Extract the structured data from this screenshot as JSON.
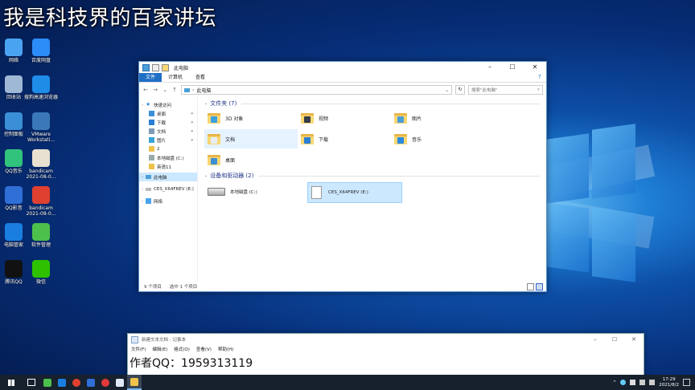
{
  "overlay_title": "我是科技界的百家讲坛",
  "desktop": {
    "icons": [
      {
        "label": "网络",
        "icon": "network-icon",
        "color": "#4aa3f0"
      },
      {
        "label": "百度网盘",
        "icon": "baidu-netdisk-icon",
        "color": "#2b8cf7"
      },
      {
        "label": "回收站",
        "icon": "recycle-bin-icon",
        "color": "#9fb8d6"
      },
      {
        "label": "搜狗高速浏览器",
        "icon": "sogou-browser-icon",
        "color": "#1f8ce8"
      },
      {
        "label": "控制面板",
        "icon": "control-panel-icon",
        "color": "#3b8fd6"
      },
      {
        "label": "VMware Workstati...",
        "icon": "vmware-icon",
        "color": "#3a78b8"
      },
      {
        "label": "QQ音乐",
        "icon": "qq-music-icon",
        "color": "#31c27c"
      },
      {
        "label": "bandicam 2021-08-0...",
        "icon": "video-file-icon",
        "color": "#e8e0d0"
      },
      {
        "label": "QQ影音",
        "icon": "qq-player-icon",
        "color": "#2f6fd6"
      },
      {
        "label": "bandicam 2021-08-0...",
        "icon": "bandicam-icon",
        "color": "#e04030"
      },
      {
        "label": "电脑管家",
        "icon": "pc-manager-icon",
        "color": "#1a7ee0"
      },
      {
        "label": "软件管理",
        "icon": "software-manager-icon",
        "color": "#4cbf4c"
      },
      {
        "label": "腾讯QQ",
        "icon": "qq-icon",
        "color": "#111111"
      },
      {
        "label": "微信",
        "icon": "wechat-icon",
        "color": "#2dc100"
      }
    ]
  },
  "explorer": {
    "title": "此电脑",
    "ribbon_tabs": [
      "文件",
      "计算机",
      "查看"
    ],
    "address": "此电脑",
    "search_placeholder": "搜索\"此电脑\"",
    "nav": {
      "quick_access": "快速访问",
      "items": [
        {
          "label": "桌面",
          "pinned": true,
          "icon": "desktop-icon",
          "color": "#3b8fd6"
        },
        {
          "label": "下载",
          "pinned": true,
          "icon": "download-icon",
          "color": "#2a7fd4"
        },
        {
          "label": "文档",
          "pinned": true,
          "icon": "documents-icon",
          "color": "#7f9bb8"
        },
        {
          "label": "图片",
          "pinned": true,
          "icon": "pictures-icon",
          "color": "#3aa3d6"
        },
        {
          "label": "2",
          "pinned": false,
          "icon": "folder-icon",
          "color": "#f0c24b"
        },
        {
          "label": "本地磁盘 (C:)",
          "pinned": false,
          "icon": "drive-icon",
          "color": "#9aa"
        },
        {
          "label": "英语11",
          "pinned": false,
          "icon": "folder-icon",
          "color": "#f0c24b"
        }
      ],
      "this_pc": "此电脑",
      "dvd": "CES_X64FREV (E:)",
      "network": "网络"
    },
    "folders_group": "文件夹 (7)",
    "folders": [
      {
        "label": "3D 对象",
        "icon": "3d-objects-icon",
        "badge": "#3aa0e0"
      },
      {
        "label": "视频",
        "icon": "videos-icon",
        "badge": "#333c48"
      },
      {
        "label": "图片",
        "icon": "pictures-icon",
        "badge": "#4a9fd8"
      },
      {
        "label": "文档",
        "icon": "documents-icon",
        "badge": "#e8eef5"
      },
      {
        "label": "下载",
        "icon": "downloads-icon",
        "badge": "#2a7fd4"
      },
      {
        "label": "音乐",
        "icon": "music-icon",
        "badge": "#2a8ae0"
      },
      {
        "label": "桌面",
        "icon": "desktop-folder-icon",
        "badge": "#3b8fd6"
      }
    ],
    "drives_group": "设备和驱动器 (2)",
    "drives": [
      {
        "label": "本地磁盘 (C:)",
        "icon": "hard-drive-icon"
      },
      {
        "label": "CES_X64FREV (E:)",
        "icon": "dvd-drive-icon"
      }
    ],
    "status": {
      "count": "9 个项目",
      "selected": "选中 1 个项目"
    }
  },
  "notepad": {
    "title": "新建文本文档 - 记事本",
    "menu": [
      "文件(F)",
      "编辑(E)",
      "格式(O)",
      "查看(V)",
      "帮助(H)"
    ],
    "content": "作者QQ：1959313119"
  },
  "taskbar": {
    "apps": [
      {
        "icon": "start-icon",
        "color": "#ffffff"
      },
      {
        "icon": "task-view-icon",
        "color": "#ffffff"
      },
      {
        "icon": "software-manager-icon",
        "color": "#4cbf4c"
      },
      {
        "icon": "pc-manager-icon",
        "color": "#1a7ee0"
      },
      {
        "icon": "bandicam-icon",
        "color": "#e04030"
      },
      {
        "icon": "qq-player-icon",
        "color": "#2f6fd6"
      },
      {
        "icon": "record-icon",
        "color": "#e03a3a"
      },
      {
        "icon": "notepad-icon",
        "color": "#dfe9f5"
      },
      {
        "icon": "file-explorer-icon",
        "color": "#f0c24b"
      }
    ],
    "time": "17:29",
    "date": "2021/8/2"
  }
}
